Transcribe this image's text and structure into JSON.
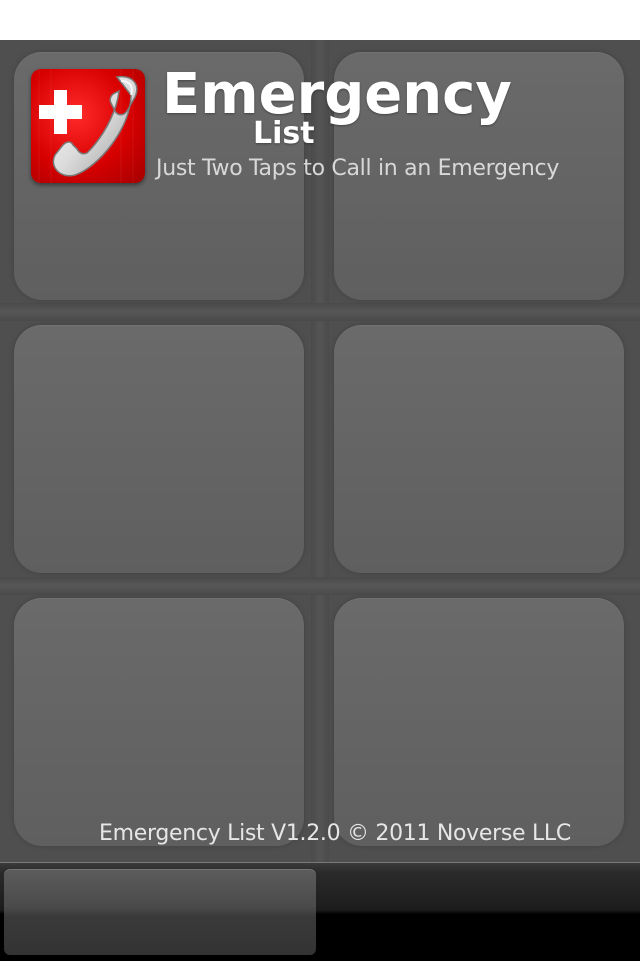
{
  "app": {
    "title": "Emergency",
    "title_sub": "List",
    "tagline": "Just Two Taps to Call in an Emergency",
    "icon": "red-phone-plus-icon"
  },
  "footer": {
    "version_text": "Emergency List V1.2.0 © 2011 Noverse LLC"
  },
  "colors": {
    "background": "#4f4f4f",
    "tile": "#666666",
    "icon_red": "#d70000",
    "bottom_bar": "#000000"
  }
}
